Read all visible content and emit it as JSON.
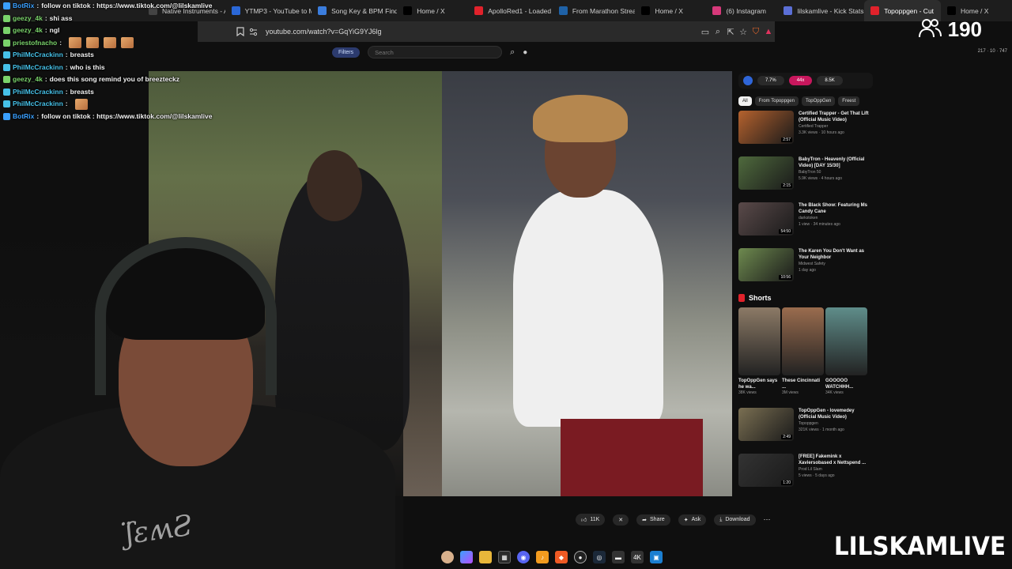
{
  "tabs": [
    {
      "label": "Native Instruments - Alt",
      "icon": "native-instruments-icon",
      "color": "#444444",
      "active": false
    },
    {
      "label": "YTMP3 - YouTube to MP",
      "icon": "ytmp3-icon",
      "color": "#2a67d6",
      "active": false
    },
    {
      "label": "Song Key & BPM Finder",
      "icon": "music-icon",
      "color": "#3b7ddd",
      "active": false
    },
    {
      "label": "Home / X",
      "icon": "x-icon",
      "color": "#000000",
      "active": false
    },
    {
      "label": "ApolloRed1 - Loaded Di",
      "icon": "youtube-icon",
      "color": "#e1222b",
      "active": false
    },
    {
      "label": "From Marathon Stream",
      "icon": "gc-icon",
      "color": "#1f62a7",
      "active": false
    },
    {
      "label": "Home / X",
      "icon": "x-icon",
      "color": "#000000",
      "active": false
    },
    {
      "label": "(6) Instagram",
      "icon": "instagram-icon",
      "color": "#d6397a",
      "active": false
    },
    {
      "label": "lilskamlive - Kick Stats, A",
      "icon": "kick-icon",
      "color": "#5b6fd6",
      "active": false
    },
    {
      "label": "Topoppgen - Cut",
      "icon": "youtube-icon",
      "color": "#e1222b",
      "active": true
    },
    {
      "label": "Home / X",
      "icon": "x-icon",
      "color": "#000000",
      "active": false
    }
  ],
  "address": {
    "url": "youtube.com/watch?v=GqYiG9YJ6lg"
  },
  "viewers": {
    "count": "190",
    "icon": "viewers-icon"
  },
  "top_stats": "217 · 10 · 747",
  "chat": [
    {
      "user": "BotRix",
      "color": "#3aa0ff",
      "message": "follow on tiktok : https://www.tiktok.com/@lilskamlive",
      "emotes": 0
    },
    {
      "user": "geezy_4k",
      "color": "#7ad36b",
      "message": "shi ass",
      "emotes": 0
    },
    {
      "user": "geezy_4k",
      "color": "#7ad36b",
      "message": "ngl",
      "emotes": 0
    },
    {
      "user": "priestofnacho",
      "color": "#7ad36b",
      "message": "",
      "emotes": 4
    },
    {
      "user": "PhilMcCrackinn",
      "color": "#46c1e8",
      "message": "breasts",
      "emotes": 0
    },
    {
      "user": "PhilMcCrackinn",
      "color": "#46c1e8",
      "message": "who is this",
      "emotes": 0
    },
    {
      "user": "geezy_4k",
      "color": "#7ad36b",
      "message": "does this song remind you of breezteckz",
      "emotes": 0
    },
    {
      "user": "PhilMcCrackinn",
      "color": "#46c1e8",
      "message": "breasts",
      "emotes": 0
    },
    {
      "user": "PhilMcCrackinn",
      "color": "#46c1e8",
      "message": "",
      "emotes": 1
    },
    {
      "user": "BotRix",
      "color": "#3aa0ff",
      "message": "follow on tiktok : https://www.tiktok.com/@lilskamlive",
      "emotes": 0
    }
  ],
  "youtube": {
    "filters_label": "Filters",
    "search_placeholder": "Search",
    "actions": {
      "likes": "11K",
      "share": "Share",
      "ask": "Ask",
      "download": "Download"
    }
  },
  "sidebar": {
    "stats_pills": [
      "7.7%",
      "44x",
      "8.5K"
    ],
    "chips": [
      "All",
      "From Topoppgen",
      "TopOppGen",
      "Freest"
    ],
    "recommendations": [
      {
        "title": "Certified Trapper - Get That Lift (Official Music Video)",
        "channel": "Certified Trapper",
        "meta": "3.3K views · 10 hours ago",
        "duration": "2:57",
        "tint": "#b5622e"
      },
      {
        "title": "BabyTron - Heavenly (Official Video) [DAY 15/30]",
        "channel": "BabyTron 50",
        "meta": "5.9K views · 4 hours ago",
        "duration": "2:15",
        "tint": "#4f6a3d"
      },
      {
        "title": "The Black Show: Featuring Ms Candy Cane",
        "channel": "darkstoken",
        "meta": "1 view · 34 minutes ago",
        "duration": "54:50",
        "tint": "#5a4a4a"
      },
      {
        "title": "The Karen You Don't Want as Your Neighbor",
        "channel": "Midwest Safety",
        "meta": "1 day ago",
        "duration": "10:56",
        "tint": "#6e8a4f"
      }
    ],
    "shorts_label": "Shorts",
    "shorts": [
      {
        "title": "TopOppGen says he wa...",
        "views": "38K views",
        "tint": "#8c7a66"
      },
      {
        "title": "These Cincinnati ...",
        "views": "3M views",
        "tint": "#9a6c4e"
      },
      {
        "title": "GOOOOO WATCHHH...",
        "views": "34K views",
        "tint": "#5f8d8a"
      }
    ],
    "more_recommendations": [
      {
        "title": "TopOppGen - lovemedey (Official Music Video)",
        "channel": "Topoppgen",
        "meta": "321K views · 1 month ago",
        "duration": "2:49",
        "tint": "#7a6f52"
      },
      {
        "title": "[FREE] Fakemink x Xaviersobased x Nettspend ...",
        "channel": "Prod Lil Slam",
        "meta": "5 views · 5 days ago",
        "duration": "1:20",
        "tint": "#333333"
      }
    ]
  },
  "watermark": "LILSKAMLIVE"
}
